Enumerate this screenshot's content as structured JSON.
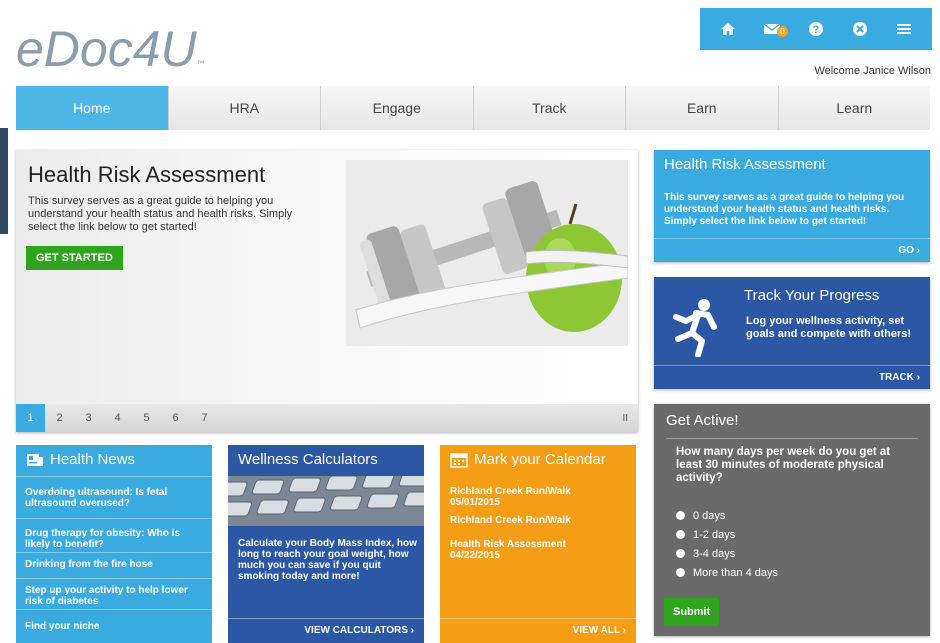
{
  "brand": {
    "logo": "eDoc4U",
    "tm": "™"
  },
  "topbar": {
    "icons": [
      "home-icon",
      "mail-icon",
      "help-icon",
      "close-icon",
      "menu-icon"
    ],
    "mail_badge": "0"
  },
  "welcome": "Welcome Janice Wilson",
  "nav": {
    "tabs": [
      "Home",
      "HRA",
      "Engage",
      "Track",
      "Earn",
      "Learn"
    ]
  },
  "hero": {
    "title": "Health Risk Assessment",
    "desc": "This survey serves as a great guide to helping you understand your health status and health risks. Simply select the link below to get started!",
    "cta": "GET STARTED",
    "pages": [
      "1",
      "2",
      "3",
      "4",
      "5",
      "6",
      "7"
    ],
    "pause": "II"
  },
  "hra_card": {
    "title": "Health Risk Assessment",
    "desc": "This survey serves as a great guide to helping you understand your health status and health risks. Simply select the link below to get started!",
    "link": "GO ›"
  },
  "track_card": {
    "title": "Track Your Progress",
    "desc": "Log your wellness activity, set goals and compete with others!",
    "link": "TRACK ›"
  },
  "active_card": {
    "title": "Get Active!",
    "question": "How many days per week do you get at least 30 minutes of moderate physical activity?",
    "options": [
      "0 days",
      "1-2 days",
      "3-4 days",
      "More than 4 days"
    ],
    "submit": "Submit"
  },
  "news": {
    "title": "Health News",
    "items": [
      "Overdoing ultrasound: Is fetal ultrasound overused?",
      "Drug therapy for obesity: Who is likely to benefit?",
      "Drinking from the fire hose",
      "Step up your activity to help lower risk of diabetes",
      "Find your niche"
    ]
  },
  "calculators": {
    "title": "Wellness Calculators",
    "desc": "Calculate your Body Mass Index, how long to reach your goal weight, how much you can save if you quit smoking today and more!",
    "link": "VIEW CALCULATORS ›"
  },
  "calendar": {
    "title": "Mark your Calendar",
    "events": [
      {
        "name": "Richland Creek Run/Walk",
        "date": "05/01/2015"
      },
      {
        "name": "Richland Creek Run/Walk",
        "date": ""
      },
      {
        "name": "Health Risk Assessment",
        "date": "04/22/2015"
      }
    ],
    "link": "VIEW ALL ›"
  }
}
